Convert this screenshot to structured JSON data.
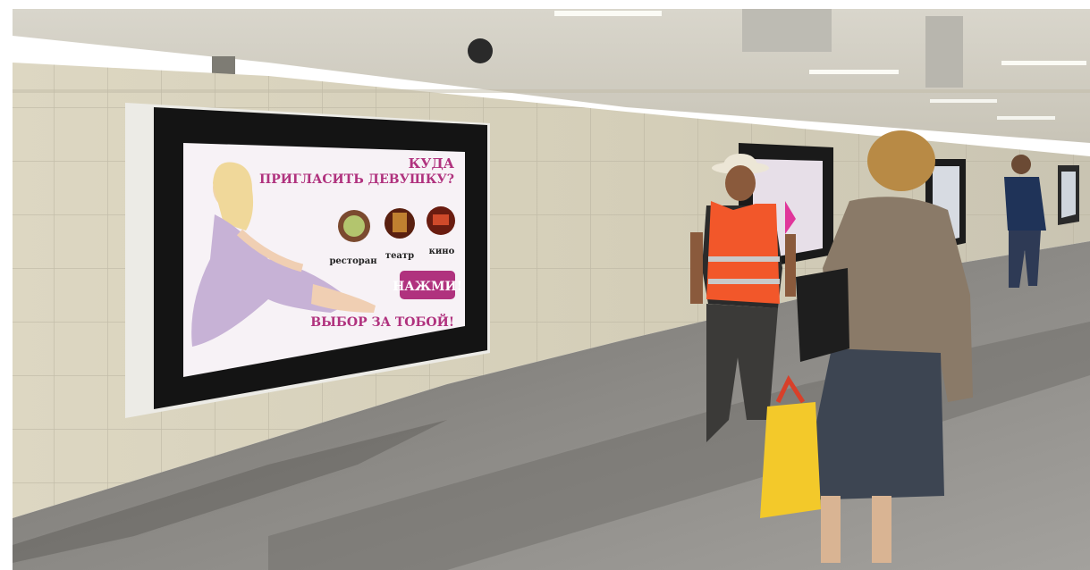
{
  "ad": {
    "headline_1": "КУДА",
    "headline_2": "ПРИГЛАСИТЬ ДЕВУШКУ?",
    "options": [
      {
        "label": "ресторан",
        "icon": "restaurant-icon"
      },
      {
        "label": "театр",
        "icon": "theatre-icon"
      },
      {
        "label": "кино",
        "icon": "cinema-icon"
      }
    ],
    "cta": "НАЖМИ!",
    "tagline": "ВЫБОР ЗА ТОБОЙ!",
    "accent_color": "#b0327e",
    "screen_color": "#f7f2f6"
  }
}
